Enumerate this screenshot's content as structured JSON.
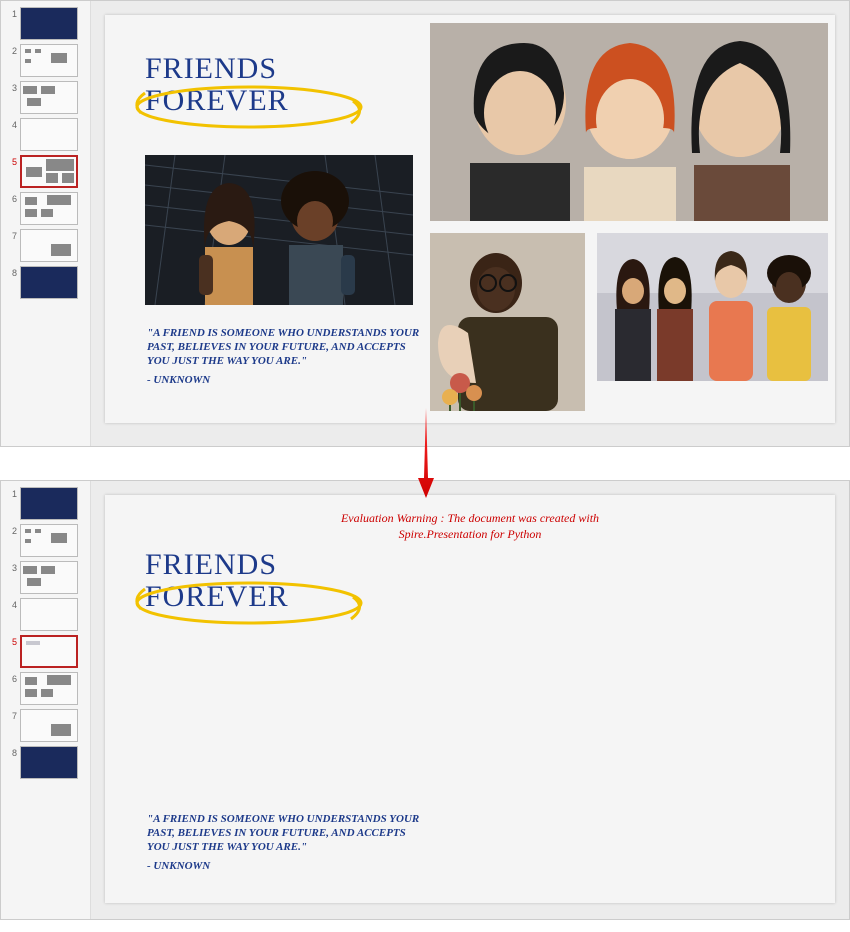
{
  "thumbs": {
    "count": 8,
    "selected": 5
  },
  "title": {
    "line1": "FRIENDS",
    "line2": "FOREVER"
  },
  "quote": {
    "text": "\"A FRIEND IS SOMEONE WHO UNDERSTANDS YOUR PAST, BELIEVES IN YOUR FUTURE, AND ACCEPTS YOU JUST THE WAY YOU ARE.\"",
    "attrib": "- UNKNOWN"
  },
  "warning": {
    "line1": "Evaluation Warning : The document was created with",
    "line2": "Spire.Presentation for Python"
  },
  "colors": {
    "title": "#1d3a8a",
    "highlight": "#f2c200",
    "warning": "#c00"
  }
}
